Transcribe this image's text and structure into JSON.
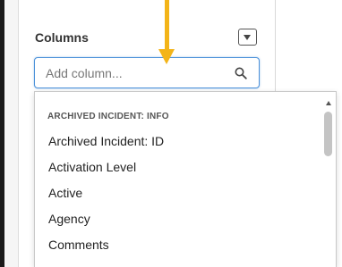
{
  "panel": {
    "title": "Columns",
    "collapse_icon": "chevron-down-icon"
  },
  "search": {
    "placeholder": "Add column...",
    "value": "",
    "icon": "search-icon"
  },
  "dropdown": {
    "group_header": "ARCHIVED INCIDENT: INFO",
    "options": [
      "Archived Incident: ID",
      "Activation Level",
      "Active",
      "Agency",
      "Comments"
    ]
  },
  "annotation": {
    "arrow_color": "#f3b418"
  },
  "colors": {
    "focus_border": "#4a90d9"
  }
}
